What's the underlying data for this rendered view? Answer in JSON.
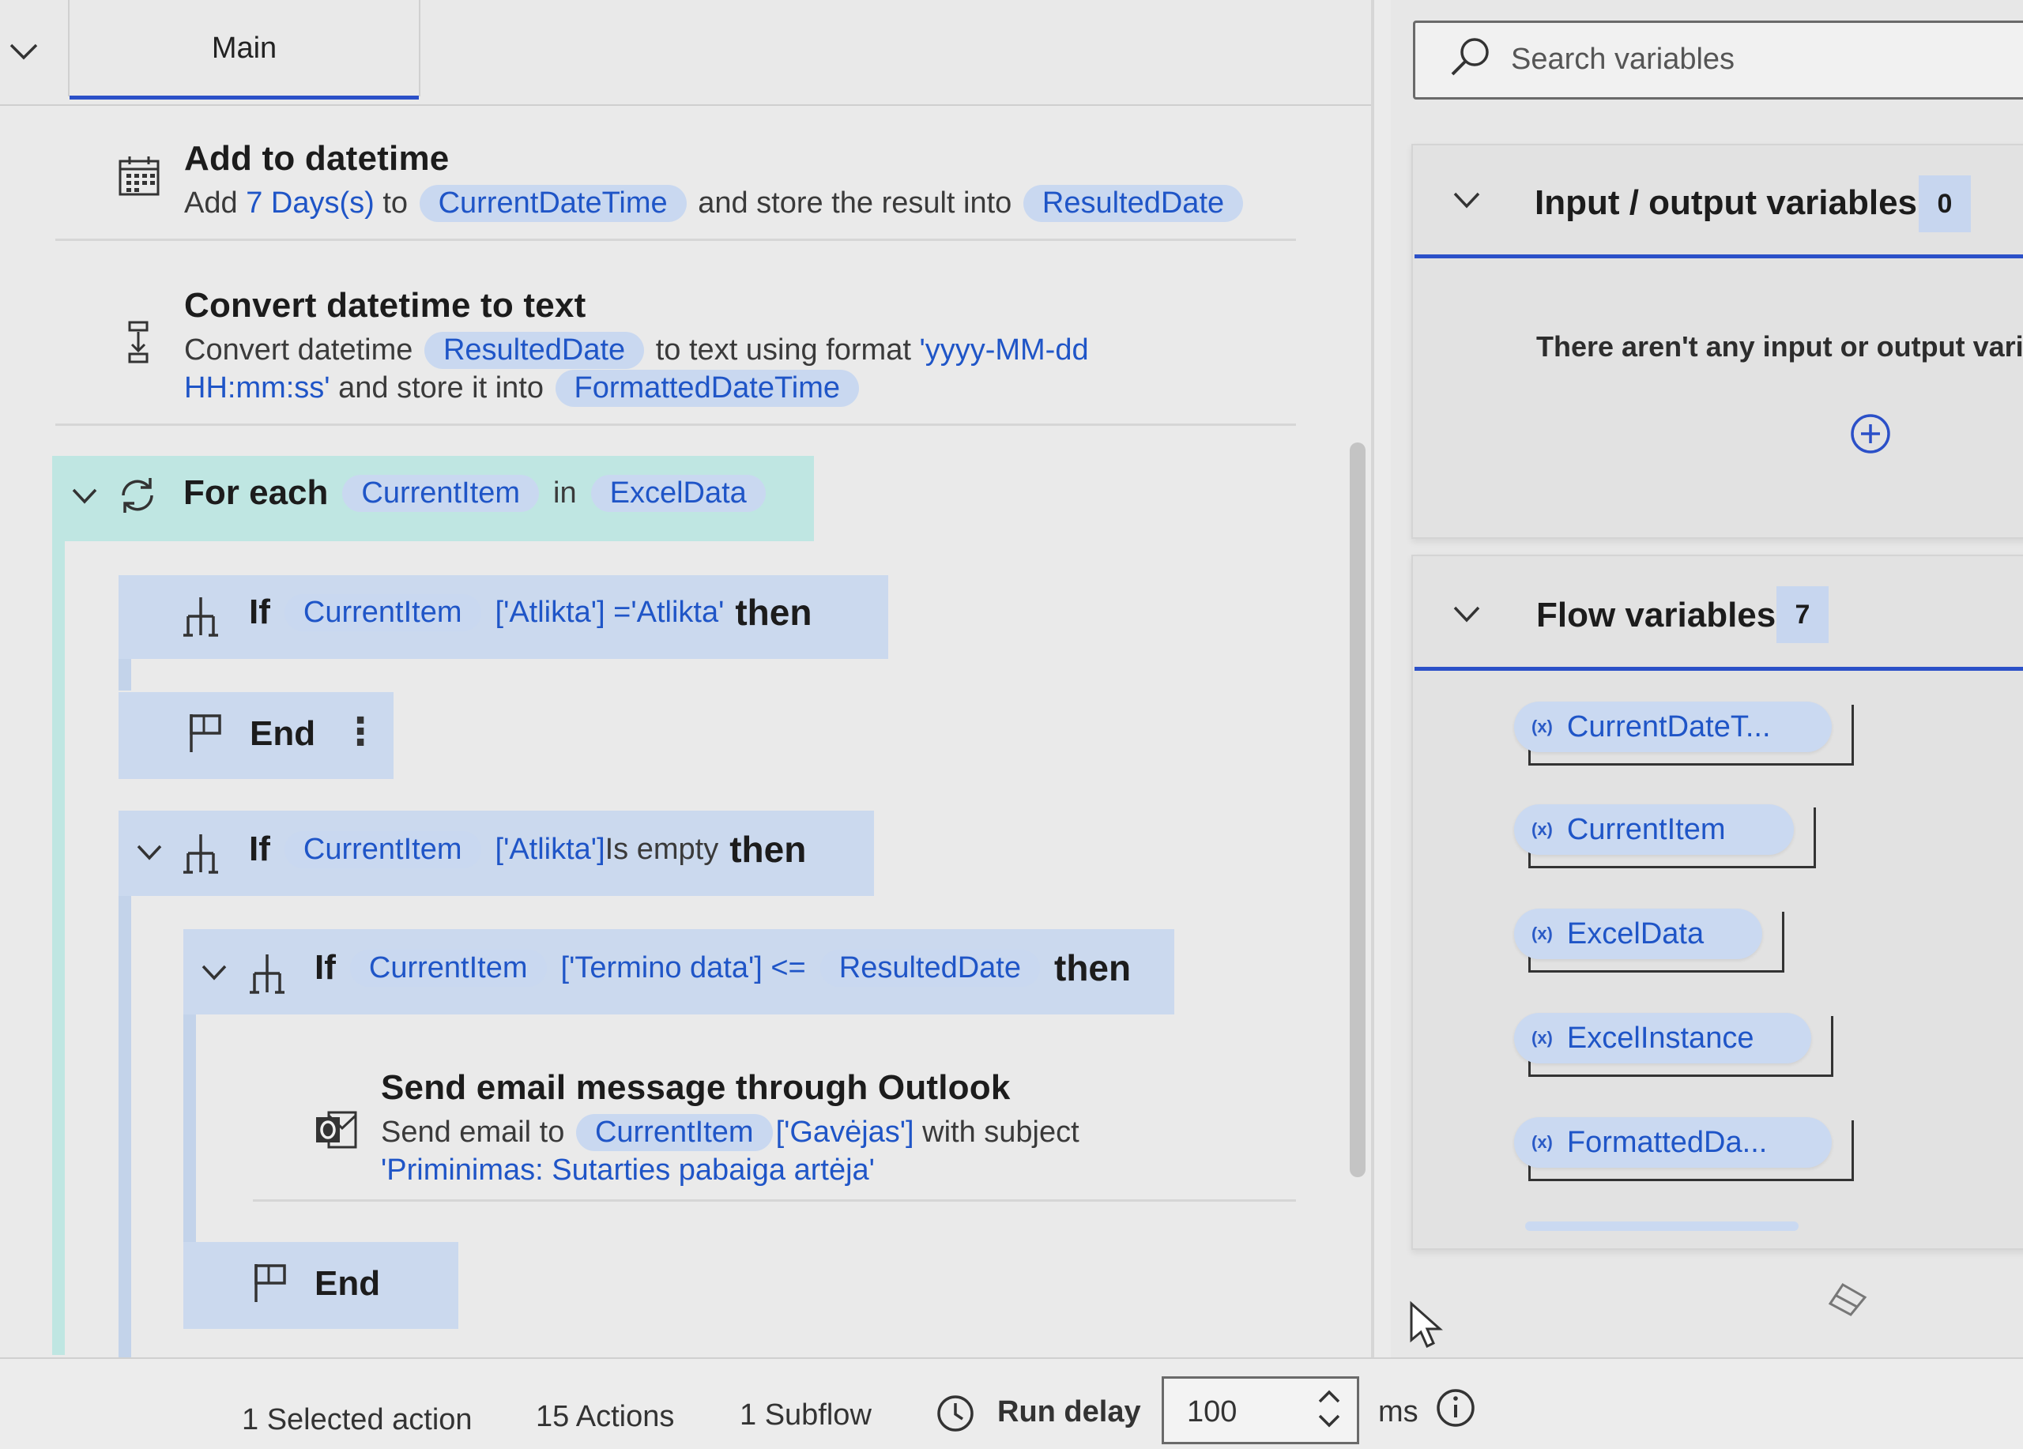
{
  "tabs": {
    "collapse_icon": "chevron-down-icon",
    "main_label": "Main"
  },
  "actions": {
    "add_datetime": {
      "title": "Add to datetime",
      "pre": "Add",
      "amount": "7",
      "unit": "Days(s)",
      "to": "to",
      "var_in": "CurrentDateTime",
      "mid": "and store the result into",
      "var_out": "ResultedDate",
      "icon": "calendar-icon"
    },
    "convert_datetime": {
      "title": "Convert datetime to text",
      "pre": "Convert datetime",
      "var_in": "ResultedDate",
      "mid": "to text using format",
      "format_a": "'yyyy-MM-dd",
      "format_b": "HH:mm:ss'",
      "mid2": "and store it into",
      "var_out": "FormattedDateTime",
      "icon": "convert-icon"
    },
    "for_each": {
      "keyword": "For each",
      "var": "CurrentItem",
      "in": "in",
      "collection": "ExcelData",
      "icon": "loop-icon"
    },
    "if1": {
      "keyword": "If",
      "var": "CurrentItem",
      "cond": "['Atlikta'] ='Atlikta'",
      "then": "then"
    },
    "end1": {
      "label": "End",
      "more": "⋮"
    },
    "if2": {
      "keyword": "If",
      "var": "CurrentItem",
      "cond_field": "['Atlikta']",
      "cond_op": "Is empty",
      "then": "then"
    },
    "if3": {
      "keyword": "If",
      "var": "CurrentItem",
      "cond": "['Termino data'] <=",
      "var2": "ResultedDate",
      "then": "then"
    },
    "send_email": {
      "title": "Send email message through Outlook",
      "pre": "Send email to",
      "var": "CurrentItem",
      "field": "['Gavėjas']",
      "mid": "with subject",
      "subject": "'Priminimas: Sutarties pabaiga artėja'",
      "icon": "outlook-icon"
    },
    "end2": {
      "label": "End"
    }
  },
  "variables_panel": {
    "search_placeholder": "Search variables",
    "io_section": {
      "title": "Input / output variables",
      "count": "0",
      "empty_text": "There aren't any input or output varia"
    },
    "flow_section": {
      "title": "Flow variables",
      "count": "7",
      "items": [
        "CurrentDateT...",
        "CurrentItem",
        "ExcelData",
        "ExcelInstance",
        "FormattedDa..."
      ],
      "var_prefix": "(x)"
    }
  },
  "status_bar": {
    "selected": "1 Selected action",
    "actions": "15 Actions",
    "subflows": "1 Subflow",
    "run_delay_label": "Run delay",
    "run_delay_value": "100",
    "unit": "ms"
  },
  "colors": {
    "accent": "#2b50c8",
    "token_bg": "#c9d8f0",
    "token_text": "#1f55c7",
    "if_block": "#cbd9ee",
    "foreach_block": "#bfe6e2"
  }
}
